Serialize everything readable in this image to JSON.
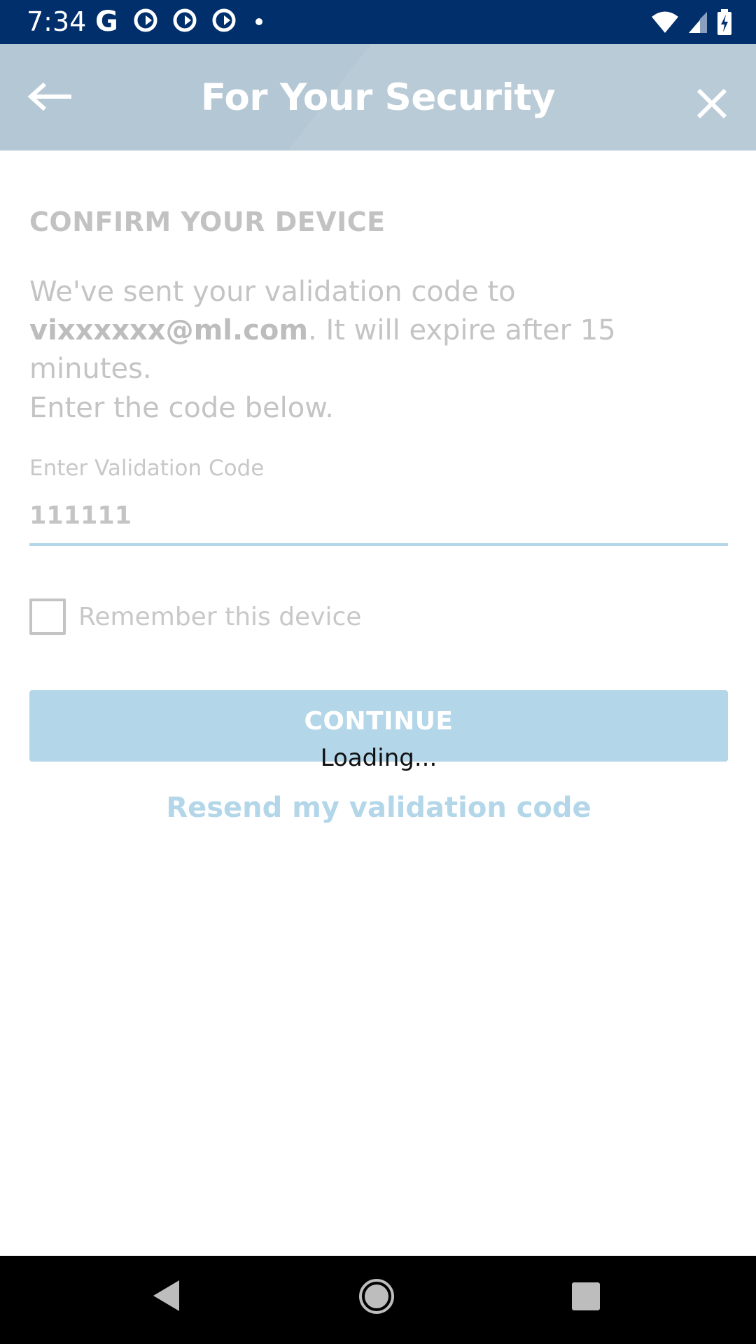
{
  "status_bar": {
    "time": "7:34",
    "left_icons": [
      "google-icon",
      "app-notification-icon",
      "app-notification-icon",
      "app-notification-icon",
      "more-dot-icon"
    ],
    "right_icons": [
      "wifi-icon",
      "cell-signal-icon",
      "battery-charging-icon"
    ],
    "background": "#002f6c"
  },
  "header": {
    "title": "For Your Security",
    "back_icon": "arrow-left-icon",
    "close_icon": "close-icon",
    "background": "#b3c7d4"
  },
  "main": {
    "section_heading": "CONFIRM YOUR DEVICE",
    "instruction_prefix": "We've sent your validation code to ",
    "email": "vixxxxxx@ml.com",
    "instruction_suffix": ". It will expire after 15 minutes.",
    "instruction_2": "Enter the code below.",
    "code_field": {
      "label": "Enter Validation Code",
      "value": "111111"
    },
    "remember_checkbox": {
      "label": "Remember this device",
      "checked": false
    },
    "continue_label": "CONTINUE",
    "loading_text": "Loading...",
    "resend_label": "Resend my validation code",
    "accent_color": "#b3d6e9"
  },
  "nav_bar": {
    "icons": [
      "nav-back-icon",
      "nav-home-icon",
      "nav-recents-icon"
    ]
  }
}
